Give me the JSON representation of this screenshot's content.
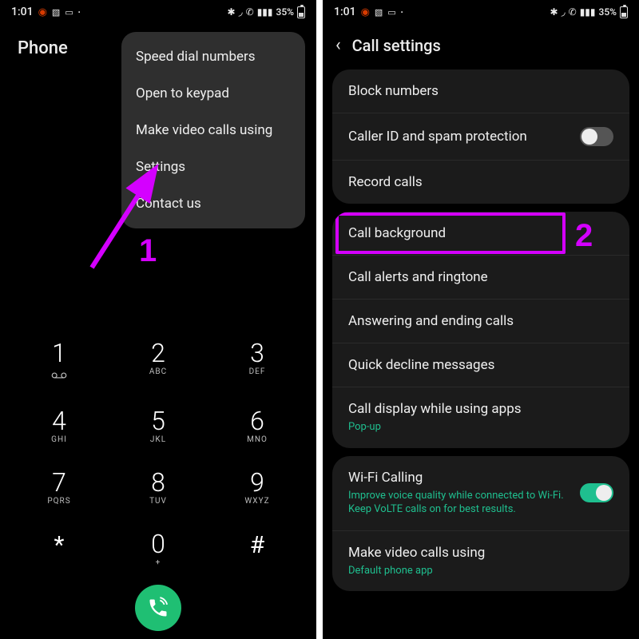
{
  "status": {
    "time": "1:01",
    "battery_text": "35%"
  },
  "annotations": {
    "step1": "1",
    "step2": "2"
  },
  "left": {
    "app_title": "Phone",
    "menu": {
      "items": [
        {
          "label": "Speed dial numbers"
        },
        {
          "label": "Open to keypad"
        },
        {
          "label": "Make video calls using"
        },
        {
          "label": "Settings"
        },
        {
          "label": "Contact us"
        }
      ]
    },
    "keypad": {
      "keys": [
        {
          "digit": "1",
          "letters": ""
        },
        {
          "digit": "2",
          "letters": "ABC"
        },
        {
          "digit": "3",
          "letters": "DEF"
        },
        {
          "digit": "4",
          "letters": "GHI"
        },
        {
          "digit": "5",
          "letters": "JKL"
        },
        {
          "digit": "6",
          "letters": "MNO"
        },
        {
          "digit": "7",
          "letters": "PQRS"
        },
        {
          "digit": "8",
          "letters": "TUV"
        },
        {
          "digit": "9",
          "letters": "WXYZ"
        },
        {
          "digit": "*",
          "letters": ""
        },
        {
          "digit": "0",
          "letters": "+"
        },
        {
          "digit": "#",
          "letters": ""
        }
      ]
    }
  },
  "right": {
    "header_title": "Call settings",
    "group1": [
      {
        "label": "Block numbers"
      },
      {
        "label": "Caller ID and spam protection",
        "toggle": "off"
      },
      {
        "label": "Record calls"
      }
    ],
    "group2": [
      {
        "label": "Call background"
      },
      {
        "label": "Call alerts and ringtone"
      },
      {
        "label": "Answering and ending calls"
      },
      {
        "label": "Quick decline messages"
      },
      {
        "label": "Call display while using apps",
        "sub": "Pop-up"
      }
    ],
    "group3": [
      {
        "label": "Wi-Fi Calling",
        "sub": "Improve voice quality while connected to Wi-Fi. Keep VoLTE calls on for best results.",
        "toggle": "on"
      },
      {
        "label": "Make video calls using",
        "sub": "Default phone app"
      }
    ]
  }
}
